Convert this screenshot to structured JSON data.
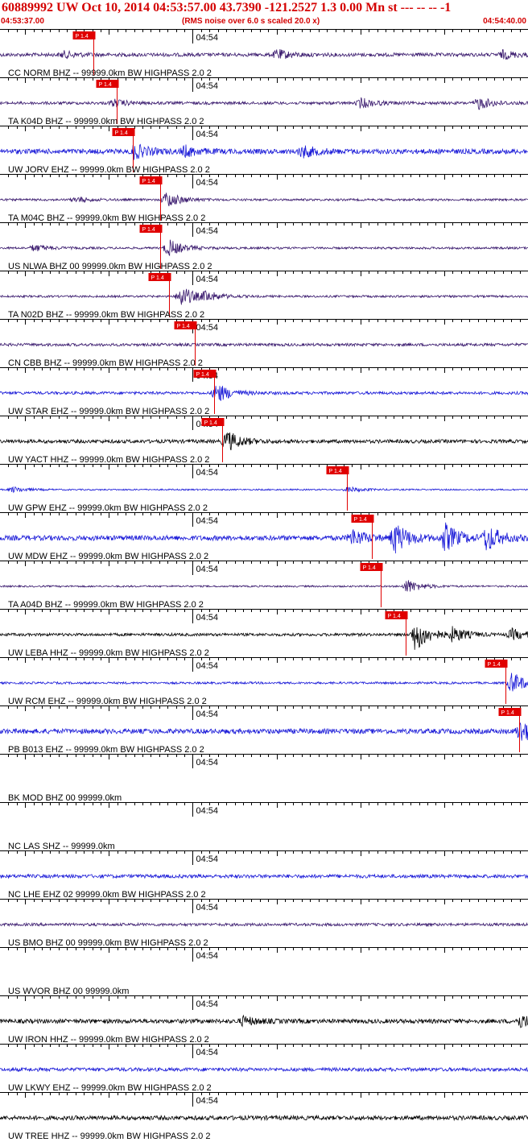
{
  "header": {
    "title": "60889992 UW Oct 10, 2014 04:53:57.00   43.7390 -121.2527  1.3 0.00 Mn st --- -- --  -1",
    "start_time": "04:53:37.00",
    "rms_note": "(RMS noise over 6.0 s scaled 20.0 x)",
    "end_time": "04:54:40.00"
  },
  "colors": {
    "header": "#d40000",
    "pick": "#e00000",
    "axis": "#000000"
  },
  "chart_data": {
    "type": "seismogram",
    "x_unit": "seconds after 04:53:37.00",
    "x_range": [
      0,
      63
    ],
    "minute_mark": {
      "label": "04:54",
      "time": 23
    },
    "pick_label": "P 1.4",
    "traces": [
      {
        "label": "CC NORM BHZ -- 99999.0km BW  HIGHPASS  2.0  2",
        "color": "#3a1a6e",
        "amplitude": 0.25,
        "pick_time": 11.1,
        "events": [
          [
            7.5,
            0.45
          ],
          [
            33,
            0.7
          ],
          [
            60,
            0.55
          ]
        ]
      },
      {
        "label": "TA K04D BHZ -- 99999.0km BW  HIGHPASS  2.0  2",
        "color": "#3a1a6e",
        "amplitude": 0.2,
        "pick_time": 13.9,
        "events": [
          [
            13.5,
            0.5
          ],
          [
            43,
            0.7
          ],
          [
            57,
            0.9
          ]
        ]
      },
      {
        "label": "UW JORV EHZ -- 99999.0km BW  HIGHPASS  2.0  2",
        "color": "#1a1ad8",
        "amplitude": 0.35,
        "pick_time": 15.8,
        "events": [
          [
            16,
            1.0
          ],
          [
            22,
            0.7
          ],
          [
            36,
            0.8
          ]
        ]
      },
      {
        "label": "TA M04C BHZ -- 99999.0km BW  HIGHPASS  2.0  2",
        "color": "#3a1a6e",
        "amplitude": 0.15,
        "pick_time": 19.1,
        "events": [
          [
            9,
            0.4
          ],
          [
            19.8,
            1.2
          ]
        ]
      },
      {
        "label": "US NLWA BHZ 00 99999.0km BW  HIGHPASS  2.0  2",
        "color": "#3a1a6e",
        "amplitude": 0.15,
        "pick_time": 19.1,
        "events": [
          [
            4,
            0.5
          ],
          [
            20,
            1.3
          ]
        ]
      },
      {
        "label": "TA N02D BHZ -- 99999.0km BW  HIGHPASS  2.0  2",
        "color": "#3a1a6e",
        "amplitude": 0.15,
        "pick_time": 20.2,
        "events": [
          [
            21.5,
            1.6
          ],
          [
            24.5,
            0.6
          ]
        ]
      },
      {
        "label": "CN CBB BHZ -- 99999.0km BW  HIGHPASS  2.0  2",
        "color": "#3a1a6e",
        "amplitude": 0.2,
        "pick_time": 23.2,
        "events": []
      },
      {
        "label": "UW STAR EHZ -- 99999.0km BW  HIGHPASS  2.0  2",
        "color": "#1a1ad8",
        "amplitude": 0.2,
        "pick_time": 25.5,
        "events": [
          [
            25.8,
            1.4
          ]
        ]
      },
      {
        "label": "UW YACT HHZ -- 99999.0km BW  HIGHPASS  2.0  2",
        "color": "#000000",
        "amplitude": 0.25,
        "pick_time": 26.5,
        "events": [
          [
            27,
            1.5
          ]
        ]
      },
      {
        "label": "UW GPW EHZ -- 99999.0km BW  HIGHPASS  2.0  2",
        "color": "#1a1ad8",
        "amplitude": 0.1,
        "pick_time": 41.4,
        "events": [
          [
            1.5,
            0.4
          ],
          [
            41.5,
            0.4
          ]
        ]
      },
      {
        "label": "UW MDW EHZ -- 99999.0km BW  HIGHPASS  2.0  2",
        "color": "#1a1ad8",
        "amplitude": 0.35,
        "pick_time": 44.4,
        "events": [
          [
            42,
            1.2
          ],
          [
            47,
            2.2
          ],
          [
            53,
            2.0
          ],
          [
            58,
            1.8
          ]
        ]
      },
      {
        "label": "TA A04D BHZ -- 99999.0km BW  HIGHPASS  2.0  2",
        "color": "#3a1a6e",
        "amplitude": 0.12,
        "pick_time": 45.4,
        "events": [
          [
            48.5,
            1.0
          ]
        ]
      },
      {
        "label": "UW LEBA HHZ -- 99999.0km BW  HIGHPASS  2.0  2",
        "color": "#000000",
        "amplitude": 0.2,
        "pick_time": 48.4,
        "events": [
          [
            49.5,
            2.4
          ],
          [
            54,
            1.0
          ],
          [
            61,
            0.8
          ]
        ]
      },
      {
        "label": "UW RCM EHZ -- 99999.0km BW  HIGHPASS  2.0  2",
        "color": "#1a1ad8",
        "amplitude": 0.15,
        "pick_time": 60.3,
        "events": [
          [
            61,
            1.6
          ]
        ]
      },
      {
        "label": "PB B013 EHZ -- 99999.0km BW  HIGHPASS  2.0  2",
        "color": "#1a1ad8",
        "amplitude": 0.35,
        "pick_time": 61.9,
        "events": [
          [
            62,
            1.6
          ]
        ]
      },
      {
        "label": "BK MOD BHZ 00 99999.0km",
        "color": "#000000",
        "amplitude": 0,
        "events": []
      },
      {
        "label": "NC LAS SHZ -- 99999.0km",
        "color": "#000000",
        "amplitude": 0,
        "events": []
      },
      {
        "label": "NC LHE EHZ 02 99999.0km BW  HIGHPASS  2.0  2",
        "color": "#1a1ad8",
        "amplitude": 0.25,
        "events": []
      },
      {
        "label": "US BMO BHZ 00 99999.0km BW  HIGHPASS  2.0  2",
        "color": "#3a1a6e",
        "amplitude": 0.2,
        "events": []
      },
      {
        "label": "US WVOR BHZ 00 99999.0km",
        "color": "#000000",
        "amplitude": 0,
        "events": []
      },
      {
        "label": "UW IRON HHZ -- 99999.0km BW  HIGHPASS  2.0  2",
        "color": "#000000",
        "amplitude": 0.3,
        "events": [
          [
            29,
            0.6
          ],
          [
            62,
            0.9
          ]
        ]
      },
      {
        "label": "UW LKWY EHZ -- 99999.0km BW  HIGHPASS  2.0  2",
        "color": "#1a1ad8",
        "amplitude": 0.25,
        "events": []
      },
      {
        "label": "UW TREE HHZ -- 99999.0km BW  HIGHPASS  2.0  2",
        "color": "#000000",
        "amplitude": 0.3,
        "events": []
      }
    ]
  }
}
